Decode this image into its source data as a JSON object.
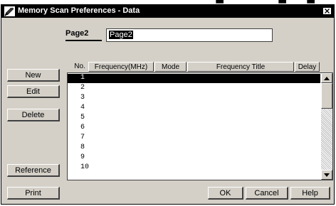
{
  "window": {
    "title": "Memory Scan Preferences - Data"
  },
  "page": {
    "label": "Page2",
    "value": "Page2"
  },
  "table": {
    "columns": [
      "No.",
      "Frequency(MHz)",
      "Mode",
      "Frequency Title",
      "Delay"
    ],
    "rows": [
      "1",
      "2",
      "3",
      "4",
      "5",
      "6",
      "7",
      "8",
      "9",
      "10"
    ],
    "selected_row": "1"
  },
  "side_buttons": {
    "new": "New",
    "edit": "Edit",
    "delete": "Delete",
    "reference": "Reference"
  },
  "bottom_buttons": {
    "print": "Print",
    "ok": "OK",
    "cancel": "Cancel",
    "help": "Help"
  },
  "icons": {
    "app": "memory-scan-icon",
    "close": "close-icon"
  },
  "colors": {
    "titlebar": "#000000",
    "dialog": "#d4d0c8",
    "selection": "#000000"
  }
}
